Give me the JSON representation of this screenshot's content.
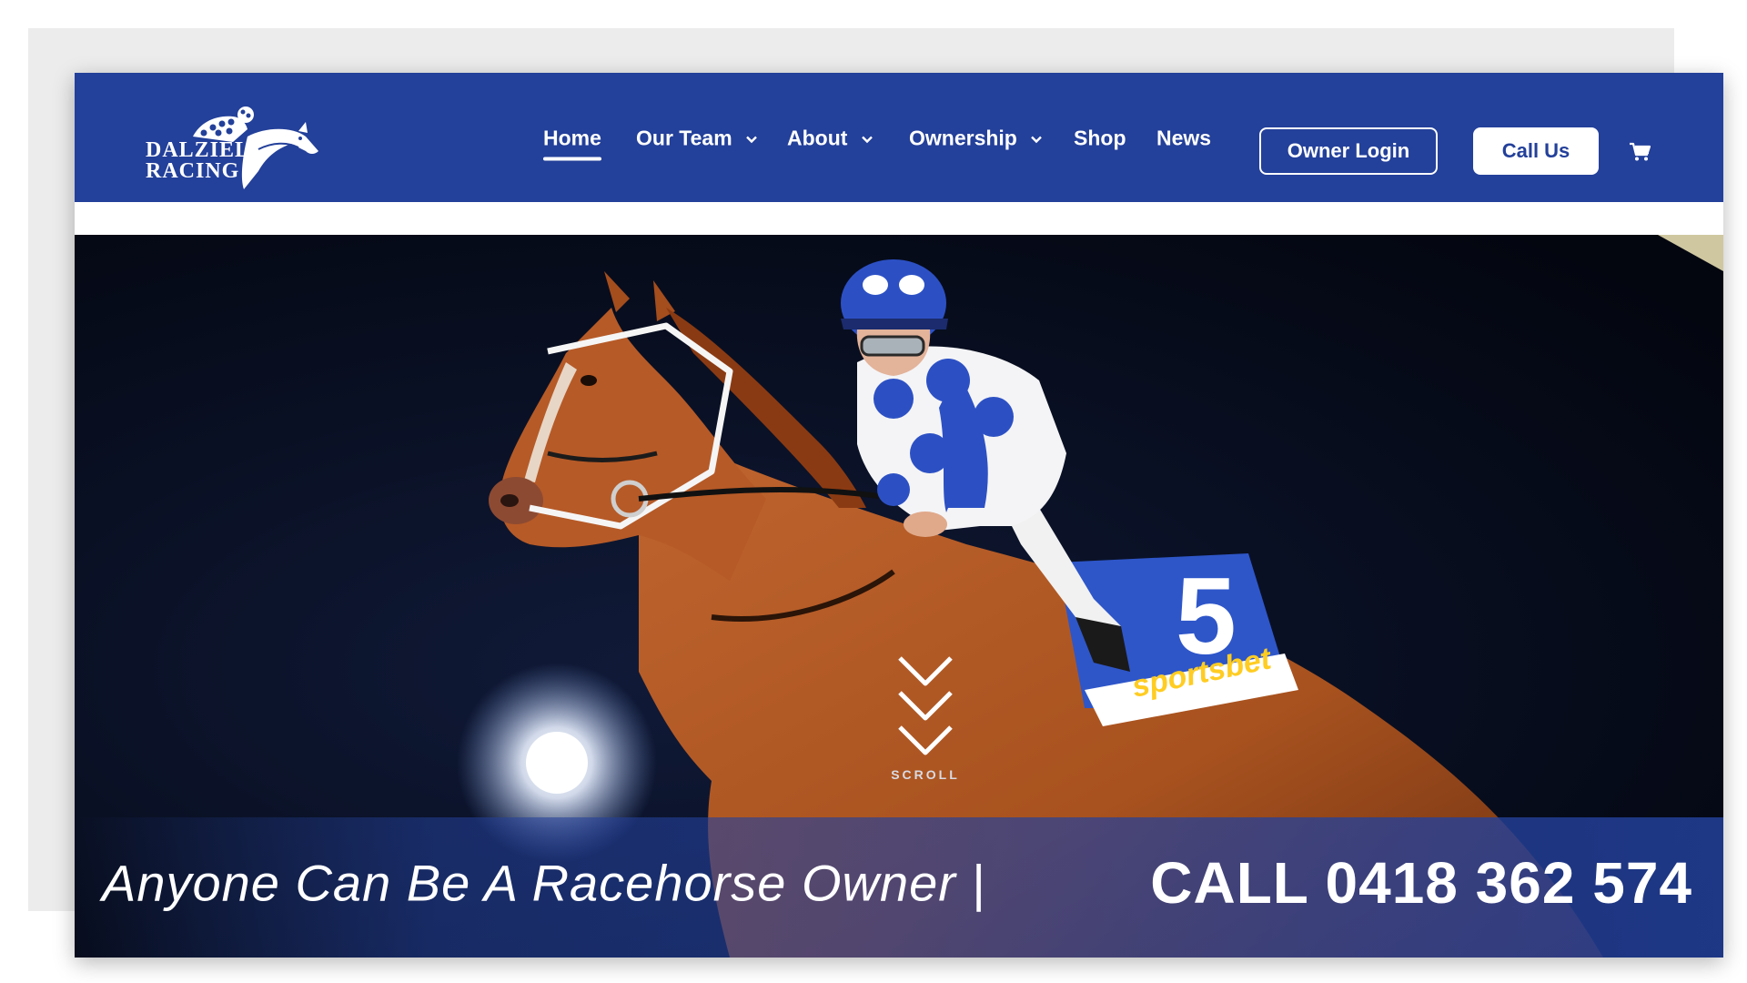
{
  "brand": {
    "name_line1": "DALZIEL",
    "name_line2": "RACING",
    "primary_color": "#23409a"
  },
  "nav": {
    "items": [
      {
        "label": "Home",
        "active": true,
        "has_dropdown": false
      },
      {
        "label": "Our Team",
        "active": false,
        "has_dropdown": true
      },
      {
        "label": "About",
        "active": false,
        "has_dropdown": true
      },
      {
        "label": "Ownership",
        "active": false,
        "has_dropdown": true
      },
      {
        "label": "Shop",
        "active": false,
        "has_dropdown": false
      },
      {
        "label": "News",
        "active": false,
        "has_dropdown": false
      }
    ],
    "owner_login_label": "Owner Login",
    "call_us_label": "Call Us",
    "cart_icon": "cart-icon"
  },
  "hero": {
    "image_subject": "racehorse-and-jockey-night",
    "saddlecloth_number": "5",
    "saddlecloth_sponsor": "sportsbet",
    "scroll_label": "SCROLL",
    "tagline": "Anyone Can Be A Racehorse Owner |",
    "phone_cta": "CALL 0418 362 574"
  }
}
